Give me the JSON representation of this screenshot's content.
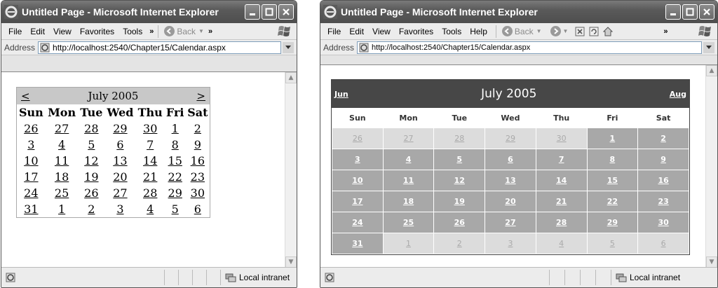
{
  "left": {
    "title": "Untitled Page - Microsoft Internet Explorer",
    "menu": [
      "File",
      "Edit",
      "View",
      "Favorites",
      "Tools"
    ],
    "overflow": "»",
    "back_label": "Back",
    "address_label": "Address",
    "url": "http://localhost:2540/Chapter15/Calendar.aspx",
    "zone": "Local intranet",
    "calendar": {
      "prev": "<",
      "next": ">",
      "month": "July 2005",
      "weekdays": [
        "Sun",
        "Mon",
        "Tue",
        "Wed",
        "Thu",
        "Fri",
        "Sat"
      ],
      "weeks": [
        [
          "26",
          "27",
          "28",
          "29",
          "30",
          "1",
          "2"
        ],
        [
          "3",
          "4",
          "5",
          "6",
          "7",
          "8",
          "9"
        ],
        [
          "10",
          "11",
          "12",
          "13",
          "14",
          "15",
          "16"
        ],
        [
          "17",
          "18",
          "19",
          "20",
          "21",
          "22",
          "23"
        ],
        [
          "24",
          "25",
          "26",
          "27",
          "28",
          "29",
          "30"
        ],
        [
          "31",
          "1",
          "2",
          "3",
          "4",
          "5",
          "6"
        ]
      ]
    }
  },
  "right": {
    "title": "Untitled Page - Microsoft Internet Explorer",
    "menu": [
      "File",
      "Edit",
      "View",
      "Favorites",
      "Tools",
      "Help"
    ],
    "overflow": "»",
    "back_label": "Back",
    "address_label": "Address",
    "url": "http://localhost:2540/Chapter15/Calendar.aspx",
    "zone": "Local intranet",
    "calendar": {
      "prev": "Jun",
      "next": "Aug",
      "month": "July 2005",
      "weekdays": [
        "Sun",
        "Mon",
        "Tue",
        "Wed",
        "Thu",
        "Fri",
        "Sat"
      ],
      "weeks": [
        [
          "26",
          "27",
          "28",
          "29",
          "30",
          "1",
          "2"
        ],
        [
          "3",
          "4",
          "5",
          "6",
          "7",
          "8",
          "9"
        ],
        [
          "10",
          "11",
          "12",
          "13",
          "14",
          "15",
          "16"
        ],
        [
          "17",
          "18",
          "19",
          "20",
          "21",
          "22",
          "23"
        ],
        [
          "24",
          "25",
          "26",
          "27",
          "28",
          "29",
          "30"
        ],
        [
          "31",
          "1",
          "2",
          "3",
          "4",
          "5",
          "6"
        ]
      ],
      "other_month": [
        [
          true,
          true,
          true,
          true,
          true,
          false,
          false
        ],
        [
          false,
          false,
          false,
          false,
          false,
          false,
          false
        ],
        [
          false,
          false,
          false,
          false,
          false,
          false,
          false
        ],
        [
          false,
          false,
          false,
          false,
          false,
          false,
          false
        ],
        [
          false,
          false,
          false,
          false,
          false,
          false,
          false
        ],
        [
          false,
          true,
          true,
          true,
          true,
          true,
          true
        ]
      ]
    }
  }
}
